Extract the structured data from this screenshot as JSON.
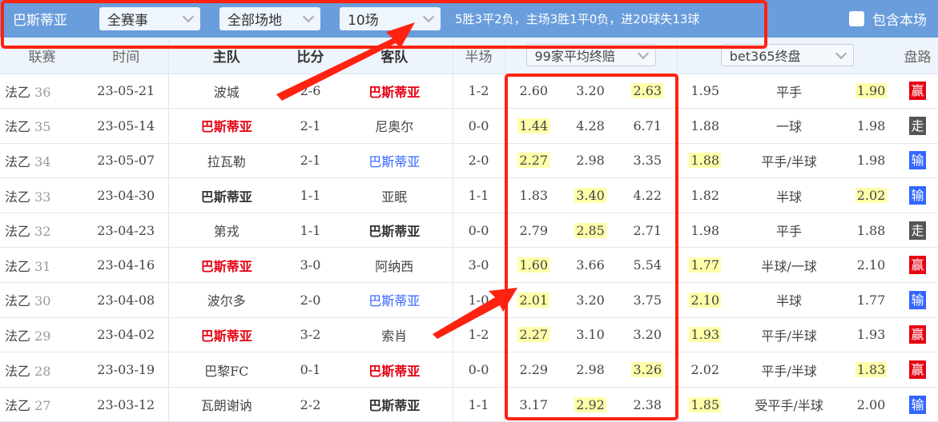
{
  "topbar": {
    "team": "巴斯蒂亚",
    "filter_competition": "全赛事",
    "filter_venue": "全部场地",
    "filter_count": "10场",
    "summary": "5胜3平2负，主场3胜1平0负，进20球失13球",
    "include_label": "包含本场"
  },
  "headers": {
    "league": "联赛",
    "time": "时间",
    "home": "主队",
    "score": "比分",
    "away": "客队",
    "half": "半场",
    "odds_select": "99家平均终赔",
    "handicap_select": "bet365终盘",
    "result": "盘路"
  },
  "colors": {
    "win": "#e60012",
    "draw": "#555555",
    "loss": "#3366ff",
    "highlight": "#ffffaa",
    "topbar": "#6a9ddc"
  },
  "rows": [
    {
      "league": "法乙",
      "round": "36",
      "date": "23-05-21",
      "home": "波城",
      "home_style": "",
      "score": "2-6",
      "away": "巴斯蒂亚",
      "away_style": "red",
      "half": "1-2",
      "odds": [
        "2.60",
        "3.20",
        "2.63"
      ],
      "odds_hl": 2,
      "hc": [
        "1.95",
        "平手",
        "1.90"
      ],
      "hc_hl": 2,
      "result": "赢",
      "result_type": "win"
    },
    {
      "league": "法乙",
      "round": "35",
      "date": "23-05-14",
      "home": "巴斯蒂亚",
      "home_style": "red",
      "score": "2-1",
      "away": "尼奥尔",
      "away_style": "",
      "half": "0-0",
      "odds": [
        "1.44",
        "4.28",
        "6.71"
      ],
      "odds_hl": 0,
      "hc": [
        "1.88",
        "一球",
        "1.98"
      ],
      "hc_hl": -1,
      "result": "走",
      "result_type": "draw"
    },
    {
      "league": "法乙",
      "round": "34",
      "date": "23-05-07",
      "home": "拉瓦勒",
      "home_style": "",
      "score": "2-1",
      "away": "巴斯蒂亚",
      "away_style": "blue",
      "half": "2-0",
      "odds": [
        "2.27",
        "2.98",
        "3.35"
      ],
      "odds_hl": 0,
      "hc": [
        "1.88",
        "平手/半球",
        "1.98"
      ],
      "hc_hl": 0,
      "result": "输",
      "result_type": "loss"
    },
    {
      "league": "法乙",
      "round": "33",
      "date": "23-04-30",
      "home": "巴斯蒂亚",
      "home_style": "blk",
      "score": "1-1",
      "away": "亚眠",
      "away_style": "",
      "half": "1-1",
      "odds": [
        "1.83",
        "3.40",
        "4.22"
      ],
      "odds_hl": 1,
      "hc": [
        "1.82",
        "半球",
        "2.02"
      ],
      "hc_hl": 2,
      "result": "输",
      "result_type": "loss"
    },
    {
      "league": "法乙",
      "round": "32",
      "date": "23-04-23",
      "home": "第戎",
      "home_style": "",
      "score": "1-1",
      "away": "巴斯蒂亚",
      "away_style": "blk",
      "half": "0-0",
      "odds": [
        "2.79",
        "2.85",
        "2.71"
      ],
      "odds_hl": 1,
      "hc": [
        "1.98",
        "平手",
        "1.88"
      ],
      "hc_hl": -1,
      "result": "走",
      "result_type": "draw"
    },
    {
      "league": "法乙",
      "round": "31",
      "date": "23-04-16",
      "home": "巴斯蒂亚",
      "home_style": "red",
      "score": "3-0",
      "away": "阿纳西",
      "away_style": "",
      "half": "3-0",
      "odds": [
        "1.60",
        "3.66",
        "5.54"
      ],
      "odds_hl": 0,
      "hc": [
        "1.77",
        "半球/一球",
        "2.10"
      ],
      "hc_hl": 0,
      "result": "赢",
      "result_type": "win"
    },
    {
      "league": "法乙",
      "round": "30",
      "date": "23-04-08",
      "home": "波尔多",
      "home_style": "",
      "score": "2-0",
      "away": "巴斯蒂亚",
      "away_style": "blue",
      "half": "1-0",
      "odds": [
        "2.01",
        "3.20",
        "3.75"
      ],
      "odds_hl": 0,
      "hc": [
        "2.10",
        "半球",
        "1.77"
      ],
      "hc_hl": 0,
      "result": "输",
      "result_type": "loss"
    },
    {
      "league": "法乙",
      "round": "29",
      "date": "23-04-02",
      "home": "巴斯蒂亚",
      "home_style": "red",
      "score": "3-2",
      "away": "索肖",
      "away_style": "",
      "half": "1-2",
      "odds": [
        "2.27",
        "3.10",
        "3.20"
      ],
      "odds_hl": 0,
      "hc": [
        "1.93",
        "平手/半球",
        "1.93"
      ],
      "hc_hl": 0,
      "result": "赢",
      "result_type": "win"
    },
    {
      "league": "法乙",
      "round": "28",
      "date": "23-03-19",
      "home": "巴黎FC",
      "home_style": "",
      "score": "0-1",
      "away": "巴斯蒂亚",
      "away_style": "red",
      "half": "0-0",
      "odds": [
        "2.29",
        "2.98",
        "3.26"
      ],
      "odds_hl": 2,
      "hc": [
        "2.02",
        "平手/半球",
        "1.83"
      ],
      "hc_hl": 2,
      "result": "赢",
      "result_type": "win"
    },
    {
      "league": "法乙",
      "round": "27",
      "date": "23-03-12",
      "home": "瓦朗谢讷",
      "home_style": "",
      "score": "2-2",
      "away": "巴斯蒂亚",
      "away_style": "blk",
      "half": "1-1",
      "odds": [
        "3.17",
        "2.92",
        "2.38"
      ],
      "odds_hl": 1,
      "hc": [
        "1.85",
        "受平手/半球",
        "2.00"
      ],
      "hc_hl": 0,
      "result": "输",
      "result_type": "loss"
    }
  ]
}
